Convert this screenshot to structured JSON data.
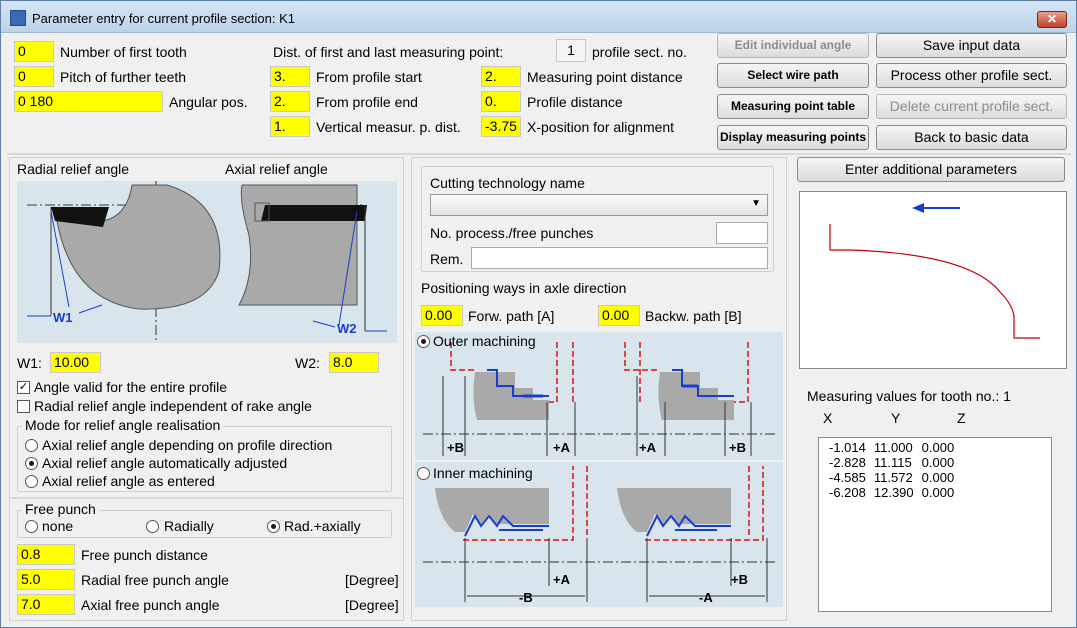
{
  "window": {
    "title": "Parameter entry for current profile section: K1",
    "close_icon": "close-icon"
  },
  "top": {
    "first_tooth_value": "0",
    "first_tooth_label": "Number of first tooth",
    "pitch_value": "0",
    "pitch_label": "Pitch of further teeth",
    "angular_value": "0 180",
    "angular_label": "Angular pos.",
    "dist_label": "Dist. of first and last measuring point:",
    "profile_sect_value": "1",
    "profile_sect_label": "profile sect. no.",
    "from_start_value": "3.",
    "from_start_label": "From profile start",
    "from_end_value": "2.",
    "from_end_label": "From profile end",
    "vertical_value": "1.",
    "vertical_label": "Vertical measur. p. dist.",
    "mp_dist_value": "2.",
    "mp_dist_label": "Measuring point distance",
    "profile_dist_value": "0.",
    "profile_dist_label": "Profile distance",
    "xpos_value": "-3.75",
    "xpos_label": "X-position for alignment"
  },
  "buttons": {
    "edit_angle": "Edit individual angle",
    "select_wire": "Select wire path",
    "mp_table": "Measuring point table",
    "display_mp": "Display measuring points",
    "save": "Save input data",
    "process_other": "Process other profile sect.",
    "delete_current": "Delete current profile sect.",
    "back": "Back to basic data",
    "additional": "Enter additional parameters"
  },
  "relief": {
    "radial_label": "Radial relief angle",
    "axial_label": "Axial relief angle",
    "w1_diag": "W1",
    "w2_diag": "W2",
    "w1_label": "W1:",
    "w1_value": "10.00",
    "w2_label": "W2:",
    "w2_value": "8.0",
    "angle_valid": "Angle valid for the entire profile",
    "radial_independent": "Radial relief angle independent of rake angle",
    "mode_title": "Mode for relief angle realisation",
    "mode_opt1": "Axial relief angle depending on profile direction",
    "mode_opt2": "Axial relief angle automatically adjusted",
    "mode_opt3": "Axial relief angle as entered"
  },
  "free_punch": {
    "title": "Free punch",
    "opt_none": "none",
    "opt_radially": "Radially",
    "opt_radaxially": "Rad.+axially",
    "distance_value": "0.8",
    "distance_label": "Free punch distance",
    "radial_value": "5.0",
    "radial_label": "Radial free punch angle",
    "axial_value": "7.0",
    "axial_label": "Axial free punch angle",
    "unit": "[Degree]"
  },
  "cutting": {
    "name_label": "Cutting technology name",
    "punches_label": "No. process./free punches",
    "rem_label": "Rem."
  },
  "positioning": {
    "title": "Positioning ways in axle direction",
    "forw_value": "0.00",
    "forw_label": "Forw. path [A]",
    "backw_value": "0.00",
    "backw_label": "Backw. path [B]",
    "outer": "Outer machining",
    "inner": "Inner machining",
    "plus_b": "+B",
    "plus_a": "+A",
    "minus_b": "-B",
    "minus_a": "-A"
  },
  "measuring": {
    "title": "Measuring values for tooth no.: 1",
    "headers": [
      "X",
      "Y",
      "Z"
    ],
    "rows": [
      [
        "-1.014",
        "11.000",
        "0.000"
      ],
      [
        "-2.828",
        "11.115",
        "0.000"
      ],
      [
        "-4.585",
        "11.572",
        "0.000"
      ],
      [
        "-6.208",
        "12.390",
        "0.000"
      ]
    ]
  },
  "colors": {
    "field_yellow": "#ffff00",
    "profile_red": "#c00000",
    "arrow_blue": "#0000cc"
  }
}
